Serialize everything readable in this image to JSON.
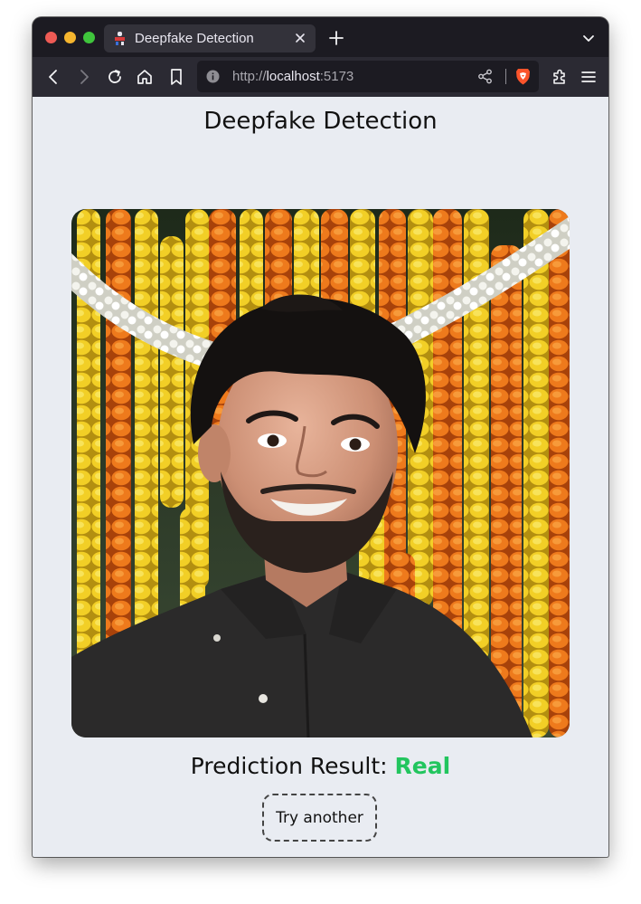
{
  "browser": {
    "tab_title": "Deepfake Detection",
    "url_scheme": "http://",
    "url_host": "localhost",
    "url_port": ":5173"
  },
  "icons": {
    "favicon": "app-favicon-icon",
    "close_tab": "close-icon",
    "new_tab": "plus-icon",
    "tab_list": "chevron-down-icon",
    "back": "back-arrow-icon",
    "forward": "forward-arrow-icon",
    "reload": "reload-icon",
    "home": "home-icon",
    "bookmark": "bookmark-icon",
    "site_info": "info-icon",
    "share": "share-icon",
    "brave_shields": "brave-lion-icon",
    "extensions": "puzzle-piece-icon",
    "menu": "hamburger-menu-icon"
  },
  "page": {
    "title": "Deepfake Detection",
    "result_label": "Prediction Result: ",
    "result_value": "Real",
    "try_button": "Try another"
  },
  "colors": {
    "page_background": "#e9ecf2",
    "result_real": "#22c55e",
    "browser_chrome": "#2b2a33"
  }
}
